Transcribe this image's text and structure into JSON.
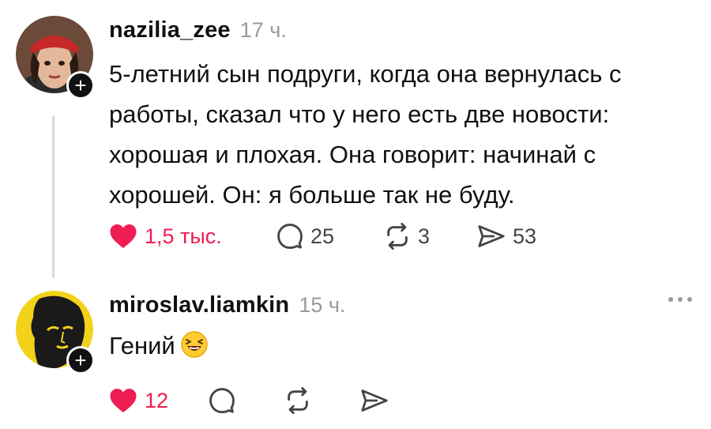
{
  "posts": [
    {
      "username": "nazilia_zee",
      "time": "17 ч.",
      "text": "5-летний сын подруги, когда она вернулась с работы, сказал что у него есть две новости: хорошая и плохая. Она говорит: начинай с хорошей. Он: я больше так не буду.",
      "likes": "1,5 тыс.",
      "comments": "25",
      "reposts": "3",
      "shares": "53"
    },
    {
      "username": "miroslav.liamkin",
      "time": "15 ч.",
      "text": "Гений",
      "likes": "12"
    }
  ],
  "colors": {
    "like": "#ee1d52",
    "muted": "#9a9a9a",
    "text": "#111111"
  }
}
